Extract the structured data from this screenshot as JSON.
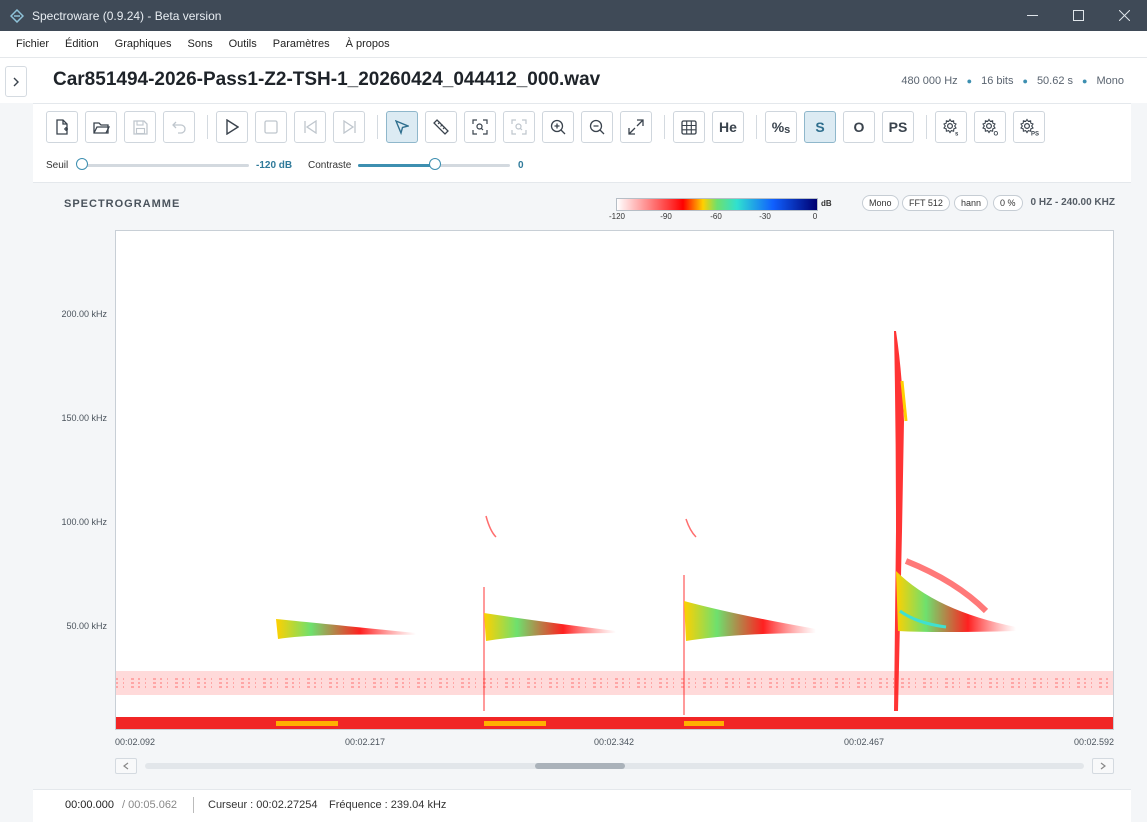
{
  "window": {
    "title": "Spectroware (0.9.24) - Beta version",
    "controls": [
      "minimize-icon",
      "maximize-icon",
      "close-icon"
    ]
  },
  "menu": [
    "Fichier",
    "Édition",
    "Graphiques",
    "Sons",
    "Outils",
    "Paramètres",
    "À propos"
  ],
  "file": {
    "name": "Car851494-2026-Pass1-Z2-TSH-1_20260424_044412_000.wav",
    "sample_rate": "480 000 Hz",
    "bits": "16 bits",
    "duration": "50.62 s",
    "channels": "Mono"
  },
  "toolbar": {
    "tools": [
      {
        "icon": "new-file-icon",
        "state": "normal"
      },
      {
        "icon": "open-folder-icon",
        "state": "normal"
      },
      {
        "icon": "save-icon",
        "state": "disabled"
      },
      {
        "icon": "undo-icon",
        "state": "disabled"
      },
      {
        "icon": "play-icon",
        "state": "normal"
      },
      {
        "icon": "stop-icon",
        "state": "disabled"
      },
      {
        "icon": "skip-start-icon",
        "state": "disabled"
      },
      {
        "icon": "skip-end-icon",
        "state": "disabled"
      },
      {
        "icon": "pointer-icon",
        "state": "active"
      },
      {
        "icon": "ruler-icon",
        "state": "normal"
      },
      {
        "icon": "zoom-selection-icon",
        "state": "normal"
      },
      {
        "icon": "zoom-selection-alt-icon",
        "state": "disabled"
      },
      {
        "icon": "zoom-in-icon",
        "state": "normal"
      },
      {
        "icon": "zoom-out-icon",
        "state": "normal"
      },
      {
        "icon": "expand-icon",
        "state": "normal"
      },
      {
        "icon": "table-icon",
        "state": "normal"
      },
      {
        "icon": "he-label",
        "label": "He",
        "state": "normal"
      },
      {
        "icon": "percent-s-label",
        "label": "%",
        "sub": "s",
        "state": "normal"
      },
      {
        "icon": "s-label",
        "label": "S",
        "state": "active"
      },
      {
        "icon": "o-label",
        "label": "O",
        "state": "normal"
      },
      {
        "icon": "ps-label",
        "label": "PS",
        "state": "normal"
      },
      {
        "icon": "settings-s-icon",
        "sub": "s",
        "state": "normal"
      },
      {
        "icon": "settings-o-icon",
        "sub": "O",
        "state": "normal"
      },
      {
        "icon": "settings-ps-icon",
        "sub": "PS",
        "state": "normal"
      }
    ]
  },
  "sliders": {
    "threshold": {
      "label": "Seuil",
      "value": "-120 dB",
      "level": 0
    },
    "contrast": {
      "label": "Contraste",
      "value": "0",
      "level": 0.5
    }
  },
  "spectrogram": {
    "title": "SPECTROGRAMME",
    "colorbar": {
      "unit": "dB",
      "ticks": [
        "-120",
        "-90",
        "-60",
        "-30",
        "0"
      ]
    },
    "pills": [
      "Mono",
      "FFT 512",
      "hann",
      "0 %"
    ],
    "range": "0 HZ - 240.00 KHZ",
    "y_ticks": [
      "200.00 kHz",
      "150.00 kHz",
      "100.00 kHz",
      "50.00 kHz"
    ],
    "x_ticks": [
      "00:02.092",
      "00:02.217",
      "00:02.342",
      "00:02.467",
      "00:02.592"
    ]
  },
  "status": {
    "position": "00:00.000",
    "total": "/ 00:05.062",
    "cursor": "Curseur : 00:02.27254",
    "frequency": "Fréquence : 239.04 kHz"
  },
  "colors": {
    "accent": "#3d8fb0",
    "titlebar": "#3f4a57"
  }
}
